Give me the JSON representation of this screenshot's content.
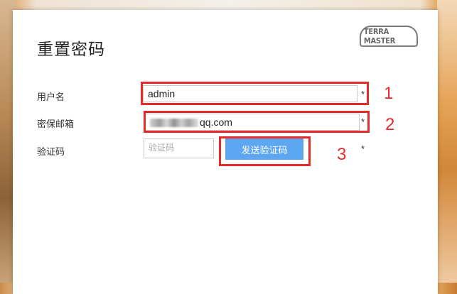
{
  "dialog": {
    "title": "重置密码",
    "logo_text": "TERRA MASTER"
  },
  "form": {
    "username": {
      "label": "用户名",
      "value": "admin",
      "required_mark": "*"
    },
    "email": {
      "label": "密保邮箱",
      "value_visible_suffix": "qq.com",
      "required_mark": "*"
    },
    "code": {
      "label": "验证码",
      "placeholder": "验证码",
      "required_mark": "*"
    },
    "send_button_label": "发送验证码"
  },
  "annotations": {
    "marker_1": "1",
    "marker_2": "2",
    "marker_3": "3",
    "marker_color": "#e52a2a"
  }
}
